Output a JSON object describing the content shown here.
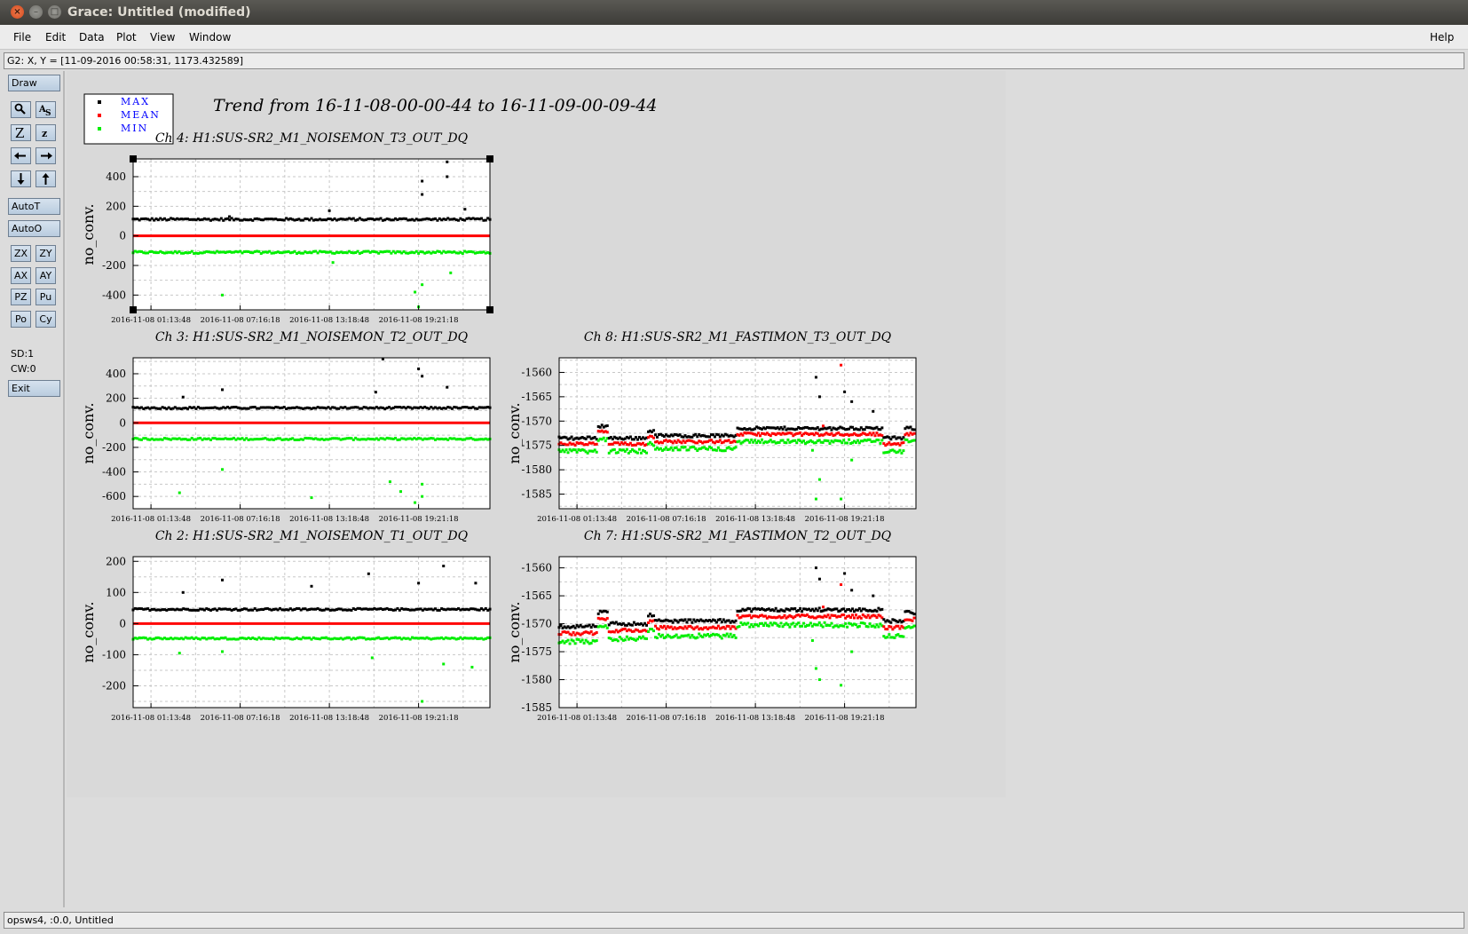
{
  "window": {
    "title": "Grace: Untitled (modified)",
    "close_glyph": "×",
    "minimize_glyph": "–",
    "maximize_glyph": "□"
  },
  "menu": {
    "file": "File",
    "edit": "Edit",
    "data": "Data",
    "plot": "Plot",
    "view": "View",
    "window": "Window",
    "help": "Help"
  },
  "locator": "G2: X, Y = [11-09-2016 00:58:31, 1173.432589]",
  "toolbar": {
    "draw": "Draw",
    "zoom_icon": "magnifier-icon",
    "autoscale_icon": "autoscale-icon",
    "zoom_x_icon": "zoom-in-icon",
    "zoom_y_icon": "zoom-out-icon",
    "left_icon": "arrow-left-icon",
    "right_icon": "arrow-right-icon",
    "down_icon": "arrow-down-icon",
    "up_icon": "arrow-up-icon",
    "autot": "AutoT",
    "autoo": "AutoO",
    "zx": "ZX",
    "zy": "ZY",
    "ax": "AX",
    "ay": "AY",
    "pz": "PZ",
    "pu": "Pu",
    "po": "Po",
    "cy": "Cy",
    "sd": "SD:1",
    "cw": "CW:0",
    "exit": "Exit"
  },
  "status": "opsws4, :0.0, Untitled",
  "chart_title": "Trend from 16-11-08-00-00-44 to 16-11-09-00-09-44",
  "legend": [
    {
      "label": "MAX",
      "color": "#000000"
    },
    {
      "label": "MEAN",
      "color": "#ff0000"
    },
    {
      "label": "MIN",
      "color": "#00ee00"
    }
  ],
  "colors": {
    "max": "#000000",
    "mean": "#ff0000",
    "min": "#00ee00",
    "legend_text": "#0000ff"
  },
  "chart_data": [
    {
      "id": "ch4",
      "type": "scatter",
      "title": "Ch 4: H1:SUS-SR2_M1_NOISEMON_T3_OUT_DQ",
      "ylabel": "no_conv.",
      "xticks": [
        "2016-11-08 01:13:48",
        "2016-11-08 07:16:18",
        "2016-11-08 13:18:48",
        "2016-11-08 19:21:18"
      ],
      "yticks": [
        "-400",
        "-200",
        "0",
        "200",
        "400"
      ],
      "ylim": [
        -500,
        520
      ],
      "max_level": 110,
      "max_noise": 15,
      "mean_level": 0,
      "min_level": -110,
      "min_noise": 15,
      "max_outliers": [
        [
          0.88,
          500
        ],
        [
          0.81,
          370
        ],
        [
          0.88,
          400
        ],
        [
          0.81,
          280
        ],
        [
          0.55,
          170
        ],
        [
          0.27,
          130
        ],
        [
          0.93,
          180
        ]
      ],
      "min_outliers": [
        [
          0.25,
          -400
        ],
        [
          0.79,
          -380
        ],
        [
          0.81,
          -330
        ],
        [
          0.8,
          -480
        ],
        [
          0.56,
          -180
        ],
        [
          0.89,
          -250
        ]
      ],
      "selected": true
    },
    {
      "id": "ch3",
      "type": "scatter",
      "title": "Ch 3: H1:SUS-SR2_M1_NOISEMON_T2_OUT_DQ",
      "ylabel": "no_conv.",
      "xticks": [
        "2016-11-08 01:13:48",
        "2016-11-08 07:16:18",
        "2016-11-08 13:18:48",
        "2016-11-08 19:21:18"
      ],
      "yticks": [
        "-600",
        "-400",
        "-200",
        "0",
        "200",
        "400"
      ],
      "ylim": [
        -700,
        530
      ],
      "max_level": 120,
      "max_noise": 15,
      "mean_level": 0,
      "min_level": -130,
      "min_noise": 15,
      "max_outliers": [
        [
          0.7,
          520
        ],
        [
          0.8,
          440
        ],
        [
          0.81,
          380
        ],
        [
          0.25,
          270
        ],
        [
          0.14,
          210
        ],
        [
          0.88,
          290
        ],
        [
          0.68,
          250
        ]
      ],
      "min_outliers": [
        [
          0.13,
          -570
        ],
        [
          0.5,
          -610
        ],
        [
          0.25,
          -380
        ],
        [
          0.81,
          -500
        ],
        [
          0.72,
          -480
        ],
        [
          0.75,
          -560
        ],
        [
          0.79,
          -650
        ],
        [
          0.81,
          -600
        ]
      ],
      "selected": false
    },
    {
      "id": "ch2",
      "type": "scatter",
      "title": "Ch 2: H1:SUS-SR2_M1_NOISEMON_T1_OUT_DQ",
      "ylabel": "no_conv.",
      "xticks": [
        "2016-11-08 01:13:48",
        "2016-11-08 07:16:18",
        "2016-11-08 13:18:48",
        "2016-11-08 19:21:18"
      ],
      "yticks": [
        "-200",
        "-100",
        "0",
        "100",
        "200"
      ],
      "ylim": [
        -270,
        215
      ],
      "max_level": 45,
      "max_noise": 6,
      "mean_level": 0,
      "min_level": -47,
      "min_noise": 6,
      "max_outliers": [
        [
          0.25,
          140
        ],
        [
          0.87,
          185
        ],
        [
          0.66,
          160
        ],
        [
          0.5,
          120
        ],
        [
          0.14,
          100
        ],
        [
          0.96,
          130
        ],
        [
          0.8,
          130
        ]
      ],
      "min_outliers": [
        [
          0.81,
          -250
        ],
        [
          0.87,
          -130
        ],
        [
          0.25,
          -90
        ],
        [
          0.67,
          -110
        ],
        [
          0.13,
          -95
        ],
        [
          0.95,
          -140
        ]
      ],
      "selected": false
    },
    {
      "id": "ch8",
      "type": "scatter",
      "title": "Ch 8: H1:SUS-SR2_M1_FASTIMON_T3_OUT_DQ",
      "ylabel": "no_conv.",
      "xticks": [
        "2016-11-08 01:13:48",
        "2016-11-08 07:16:18",
        "2016-11-08 13:18:48",
        "2016-11-08 19:21:18"
      ],
      "yticks": [
        "-1585",
        "-1580",
        "-1575",
        "-1570",
        "-1565",
        "-1560"
      ],
      "ylim": [
        -1588,
        -1557
      ],
      "segments": [
        [
          0.0,
          0.11,
          -1574.5
        ],
        [
          0.11,
          0.14,
          -1572.0
        ],
        [
          0.14,
          0.25,
          -1574.5
        ],
        [
          0.25,
          0.27,
          -1573.0
        ],
        [
          0.27,
          0.5,
          -1574.0
        ],
        [
          0.5,
          0.91,
          -1572.5
        ],
        [
          0.91,
          0.97,
          -1574.5
        ],
        [
          0.97,
          1.0,
          -1572.5
        ]
      ],
      "max_outliers": [
        [
          0.72,
          -1561
        ],
        [
          0.8,
          -1564
        ],
        [
          0.82,
          -1566
        ],
        [
          0.88,
          -1568
        ],
        [
          0.73,
          -1565
        ]
      ],
      "mean_outliers": [
        [
          0.79,
          -1558.5
        ],
        [
          0.74,
          -1571
        ]
      ],
      "min_outliers": [
        [
          0.73,
          -1582
        ],
        [
          0.79,
          -1586
        ],
        [
          0.82,
          -1578
        ],
        [
          0.72,
          -1586
        ],
        [
          0.71,
          -1576
        ]
      ],
      "selected": false
    },
    {
      "id": "ch7",
      "type": "scatter",
      "title": "Ch 7: H1:SUS-SR2_M1_FASTIMON_T2_OUT_DQ",
      "ylabel": "no_conv.",
      "xticks": [
        "2016-11-08 01:13:48",
        "2016-11-08 07:16:18",
        "2016-11-08 13:18:48",
        "2016-11-08 19:21:18"
      ],
      "yticks": [
        "-1585",
        "-1580",
        "-1575",
        "-1570",
        "-1565",
        "-1560"
      ],
      "ylim": [
        -1585,
        -1558
      ],
      "segments": [
        [
          0.0,
          0.11,
          -1571.5
        ],
        [
          0.11,
          0.14,
          -1569.0
        ],
        [
          0.14,
          0.25,
          -1571.0
        ],
        [
          0.25,
          0.27,
          -1569.5
        ],
        [
          0.27,
          0.5,
          -1570.5
        ],
        [
          0.5,
          0.91,
          -1568.5
        ],
        [
          0.91,
          0.97,
          -1570.5
        ],
        [
          0.97,
          1.0,
          -1569.0
        ]
      ],
      "max_outliers": [
        [
          0.72,
          -1560
        ],
        [
          0.8,
          -1561
        ],
        [
          0.82,
          -1564
        ],
        [
          0.88,
          -1565
        ],
        [
          0.73,
          -1562
        ]
      ],
      "mean_outliers": [
        [
          0.79,
          -1563
        ],
        [
          0.74,
          -1567
        ]
      ],
      "min_outliers": [
        [
          0.73,
          -1580
        ],
        [
          0.79,
          -1581
        ],
        [
          0.82,
          -1575
        ],
        [
          0.72,
          -1578
        ],
        [
          0.71,
          -1573
        ]
      ],
      "selected": false
    }
  ]
}
